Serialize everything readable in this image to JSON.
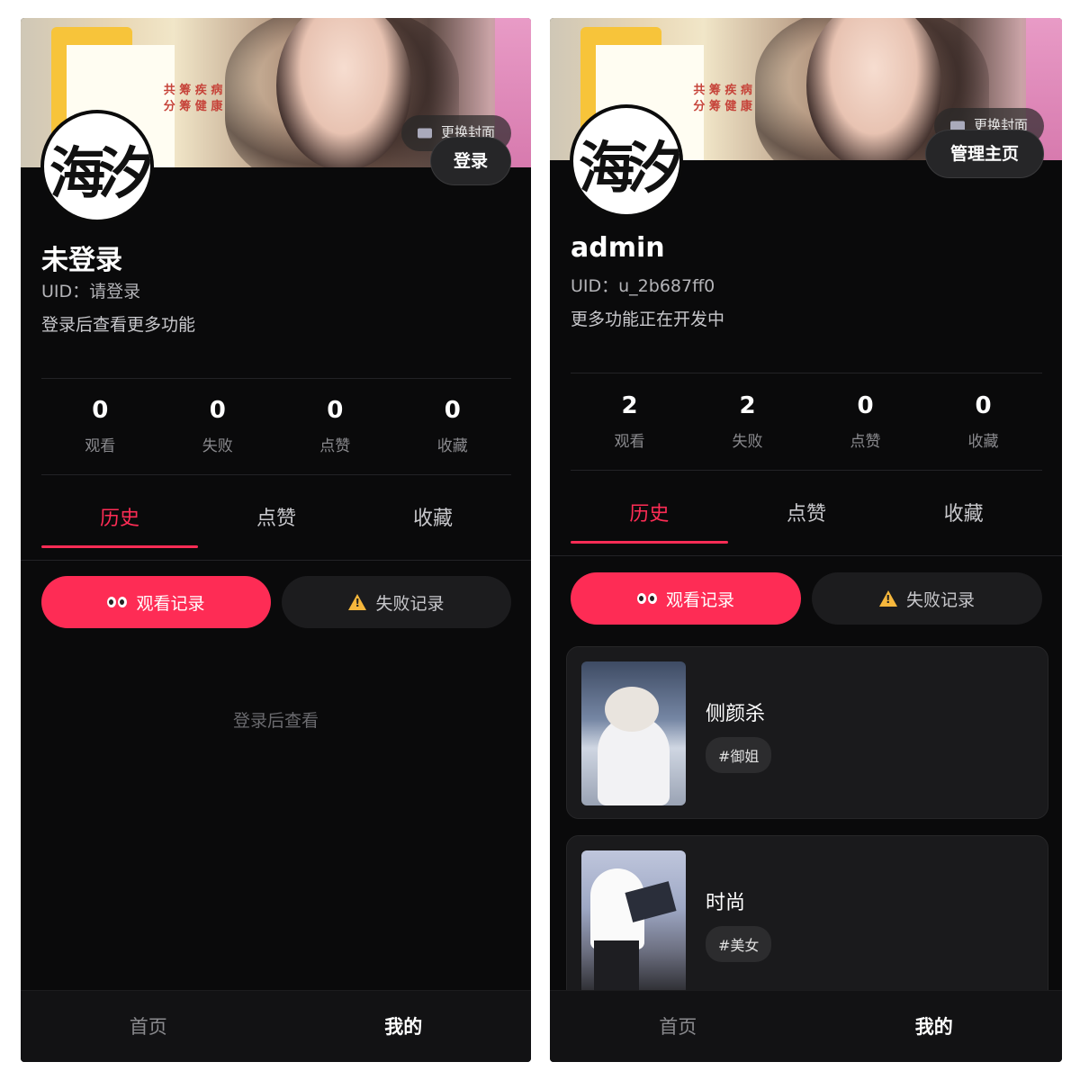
{
  "screens": [
    {
      "cover_button": "更换封面",
      "action_button": "登录",
      "avatar_text": "海汐",
      "name": "未登录",
      "uid": "UID：请登录",
      "bio": "登录后查看更多功能",
      "stats": [
        {
          "value": "0",
          "label": "观看"
        },
        {
          "value": "0",
          "label": "失败"
        },
        {
          "value": "0",
          "label": "点赞"
        },
        {
          "value": "0",
          "label": "收藏"
        }
      ],
      "tabs": [
        "历史",
        "点赞",
        "收藏"
      ],
      "active_tab": "历史",
      "subtabs": [
        {
          "label": "观看记录",
          "icon": "eyes-icon",
          "active": true
        },
        {
          "label": "失败记录",
          "icon": "warning-icon",
          "active": false
        }
      ],
      "empty_text": "登录后查看",
      "nav": [
        {
          "label": "首页",
          "active": false
        },
        {
          "label": "我的",
          "active": true
        }
      ]
    },
    {
      "cover_button": "更换封面",
      "action_button": "管理主页",
      "avatar_text": "海汐",
      "name": "admin",
      "uid": "UID：u_2b687ff0",
      "bio": "更多功能正在开发中",
      "stats": [
        {
          "value": "2",
          "label": "观看"
        },
        {
          "value": "2",
          "label": "失败"
        },
        {
          "value": "0",
          "label": "点赞"
        },
        {
          "value": "0",
          "label": "收藏"
        }
      ],
      "tabs": [
        "历史",
        "点赞",
        "收藏"
      ],
      "active_tab": "历史",
      "subtabs": [
        {
          "label": "观看记录",
          "icon": "eyes-icon",
          "active": true
        },
        {
          "label": "失败记录",
          "icon": "warning-icon",
          "active": false
        }
      ],
      "cards": [
        {
          "title": "侧颜杀",
          "tag": "#御姐"
        },
        {
          "title": "时尚",
          "tag": "#美女"
        }
      ],
      "nav": [
        {
          "label": "首页",
          "active": false
        },
        {
          "label": "我的",
          "active": true
        }
      ]
    }
  ],
  "colors": {
    "accent": "#fe2c55",
    "background": "#0a0a0b",
    "warning": "#f6b73c"
  }
}
